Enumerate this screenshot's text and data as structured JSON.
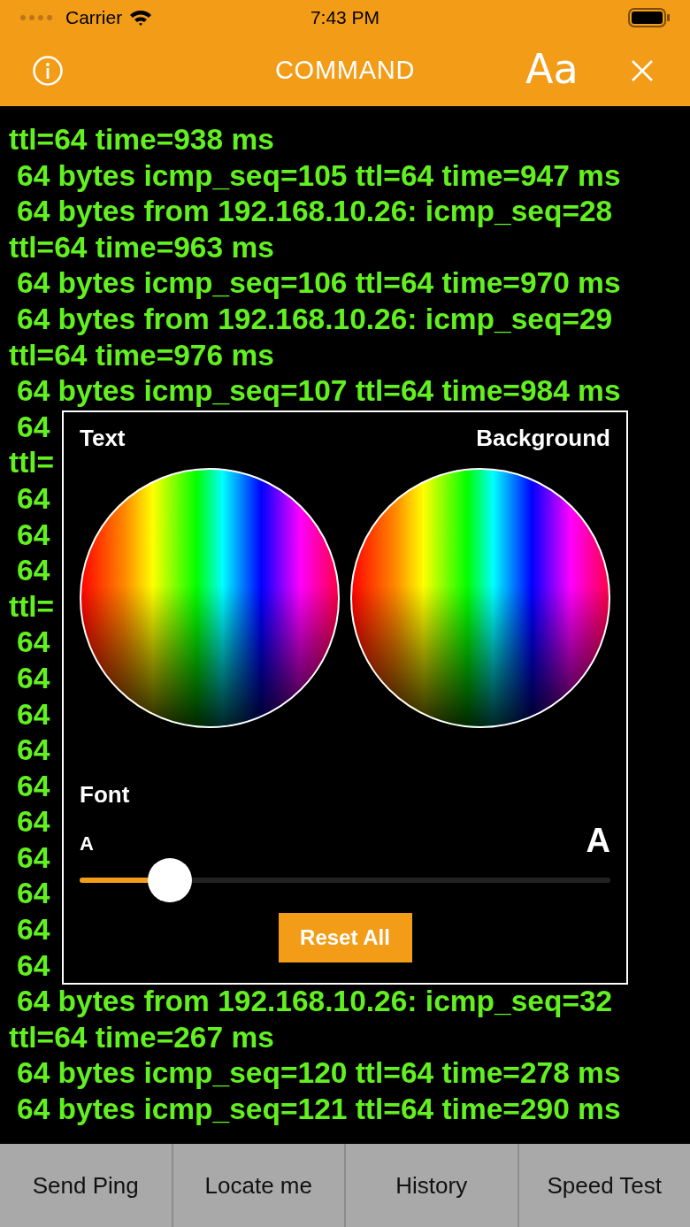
{
  "status_bar": {
    "carrier": "Carrier",
    "time": "7:43 PM"
  },
  "nav": {
    "title": "COMMAND",
    "font_button": "Aa"
  },
  "log": [
    {
      "text": "ttl=64 time=938 ms",
      "kind": "wrap"
    },
    {
      "text": "64 bytes icmp_seq=105 ttl=64 time=947 ms",
      "kind": "reply"
    },
    {
      "text": "64 bytes from 192.168.10.26: icmp_seq=28",
      "kind": "reply"
    },
    {
      "text": "ttl=64 time=963 ms",
      "kind": "wrap"
    },
    {
      "text": "64 bytes icmp_seq=106 ttl=64 time=970 ms",
      "kind": "reply"
    },
    {
      "text": "64 bytes from 192.168.10.26: icmp_seq=29",
      "kind": "reply"
    },
    {
      "text": "ttl=64 time=976 ms",
      "kind": "wrap"
    },
    {
      "text": "64 bytes icmp_seq=107 ttl=64 time=984 ms",
      "kind": "reply"
    },
    {
      "text": "64",
      "kind": "reply"
    },
    {
      "text": "ttl=",
      "kind": "wrap"
    },
    {
      "text": "64",
      "kind": "reply"
    },
    {
      "text": "64",
      "kind": "reply"
    },
    {
      "text": "64",
      "kind": "reply"
    },
    {
      "text": "ttl=",
      "kind": "wrap"
    },
    {
      "text": "64",
      "kind": "reply"
    },
    {
      "text": "64",
      "kind": "reply"
    },
    {
      "text": "64",
      "kind": "reply"
    },
    {
      "text": "64",
      "kind": "reply"
    },
    {
      "text": "64",
      "kind": "reply"
    },
    {
      "text": "64",
      "kind": "reply"
    },
    {
      "text": "64",
      "kind": "reply"
    },
    {
      "text": "64",
      "kind": "reply"
    },
    {
      "text": "64",
      "kind": "reply"
    },
    {
      "text": "64",
      "kind": "reply"
    },
    {
      "text": "64 bytes from 192.168.10.26: icmp_seq=32",
      "kind": "reply"
    },
    {
      "text": "ttl=64 time=267 ms",
      "kind": "wrap"
    },
    {
      "text": "64 bytes icmp_seq=120 ttl=64 time=278 ms",
      "kind": "reply"
    },
    {
      "text": "64 bytes icmp_seq=121 ttl=64 time=290 ms",
      "kind": "reply"
    }
  ],
  "appearance_panel": {
    "text_label": "Text",
    "background_label": "Background",
    "font_label": "Font",
    "small_a": "A",
    "large_a": "A",
    "font_size": {
      "level": 0.17
    },
    "reset_button": "Reset All"
  },
  "tabs": [
    {
      "label": "Send Ping"
    },
    {
      "label": "Locate me"
    },
    {
      "label": "History"
    },
    {
      "label": "Speed Test"
    }
  ]
}
